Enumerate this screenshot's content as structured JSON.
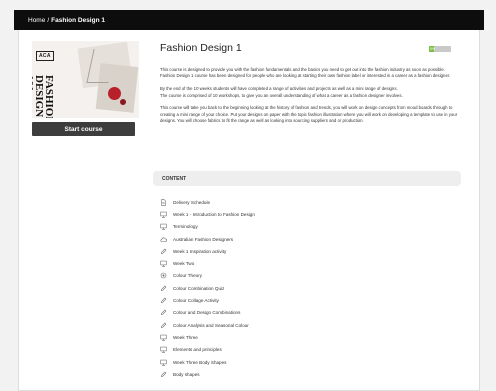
{
  "breadcrumb": {
    "home": "Home",
    "separator": "/",
    "current": "Fashion Design 1"
  },
  "course": {
    "title": "Fashion Design 1",
    "progress_percent": 0,
    "progress_label": "0%",
    "start_button": "Start course",
    "cover": {
      "logo": "ACA",
      "title_line1": "FASHION",
      "title_line2": "DESIGN",
      "title_line3": "101"
    },
    "description": [
      "This course is designed to provide you with the fashion fundamentals and the basics you need to get out into the fashion industry as soon as possible. Fashion Design 1 course has been designed for people who are looking at starting their own fashion label or interested in a career as a fashion designer.",
      "By the end of the 10 weeks students will have completed a range of activities and projects as well as a mini range of designs.",
      "The course is comprised of 10 workshops, to give you an overall understanding of what a career as a fashion designer involves.",
      "This course will take you back to the beginning looking at the history of fashion and trends, you will work on design concepts from mood boards through to creating a mini range of your choice. Put your designs on paper with the topic fashion illustration where you will work on developing a template to use in your designs. You will choose fabrics to fit the range as well as looking into sourcing suppliers and or production."
    ]
  },
  "content": {
    "header": "CONTENT",
    "items": [
      {
        "label": "Delivery Schedule",
        "icon": "document-icon"
      },
      {
        "label": "Week 1 - Introduction to Fashion Design",
        "icon": "presentation-icon"
      },
      {
        "label": "Terminology",
        "icon": "presentation-icon"
      },
      {
        "label": "Australian Fashion Designers",
        "icon": "cloud-icon"
      },
      {
        "label": "Week 1 Inspiration activity",
        "icon": "pencil-icon"
      },
      {
        "label": "Week Two",
        "icon": "presentation-icon"
      },
      {
        "label": "Colour Theory",
        "icon": "target-icon"
      },
      {
        "label": "Colour Combination Quiz",
        "icon": "pencil-icon"
      },
      {
        "label": "Colour Collage Activity",
        "icon": "pencil-icon"
      },
      {
        "label": "Colour and Design Combinations",
        "icon": "pencil-icon"
      },
      {
        "label": "Colour Analysis and Seasonal Colour",
        "icon": "pencil-icon"
      },
      {
        "label": "Week Three",
        "icon": "presentation-icon"
      },
      {
        "label": "Elements and principles",
        "icon": "presentation-icon"
      },
      {
        "label": "Week Three Body Shapes",
        "icon": "presentation-icon"
      },
      {
        "label": "Body shapes",
        "icon": "pencil-icon"
      }
    ]
  },
  "colors": {
    "topbar": "#0d0d0d",
    "button": "#3d3d3d",
    "progress_fill": "#7ac143",
    "accent_rose": "#b8202a"
  }
}
